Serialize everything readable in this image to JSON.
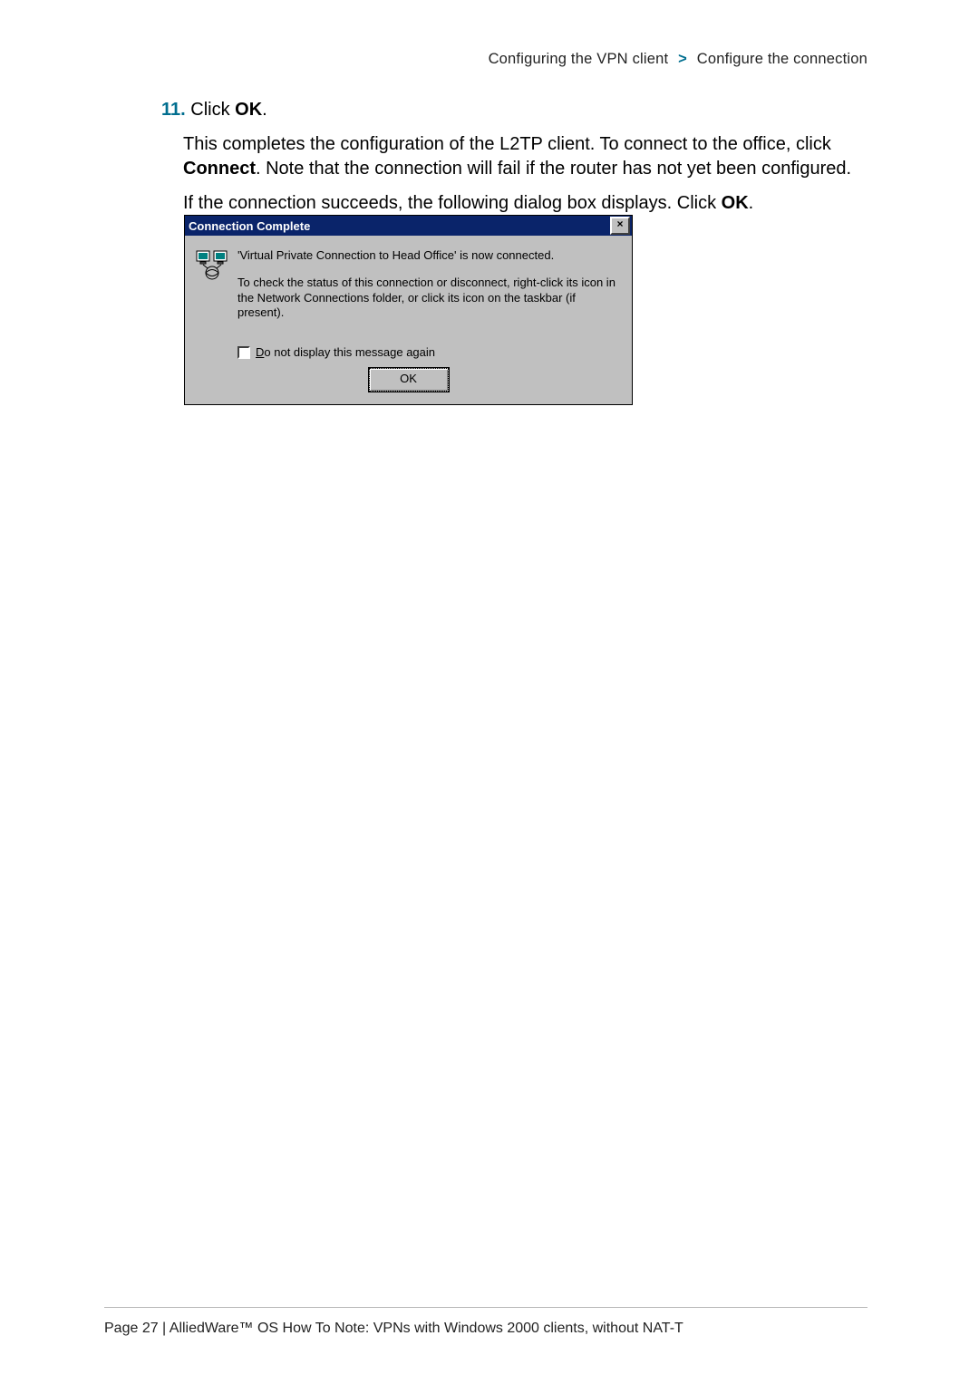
{
  "breadcrumb": {
    "section": "Configuring the VPN client",
    "subsection": "Configure the connection"
  },
  "step": {
    "number": "11.",
    "prefix": "Click ",
    "bold": "OK",
    "suffix": "."
  },
  "para1": {
    "a": "This completes the configuration of the L2TP client. To connect to the office, click ",
    "bold": "Connect",
    "b": ". Note that the connection will fail if the router has not yet been configured."
  },
  "para2": {
    "a": "If the connection succeeds, the following dialog box displays. Click ",
    "bold": "OK",
    "b": "."
  },
  "dialog": {
    "title": "Connection Complete",
    "close_glyph": "×",
    "msg1": "'Virtual Private Connection to Head Office' is now connected.",
    "msg2": "To check the status of this connection or disconnect, right-click its icon in the Network Connections folder, or click its icon on the taskbar (if present).",
    "checkbox_first_letter": "D",
    "checkbox_rest": "o not display this message again",
    "ok_label": "OK"
  },
  "footer": {
    "text": "Page 27 | AlliedWare™ OS How To Note: VPNs with Windows 2000 clients, without NAT-T"
  }
}
